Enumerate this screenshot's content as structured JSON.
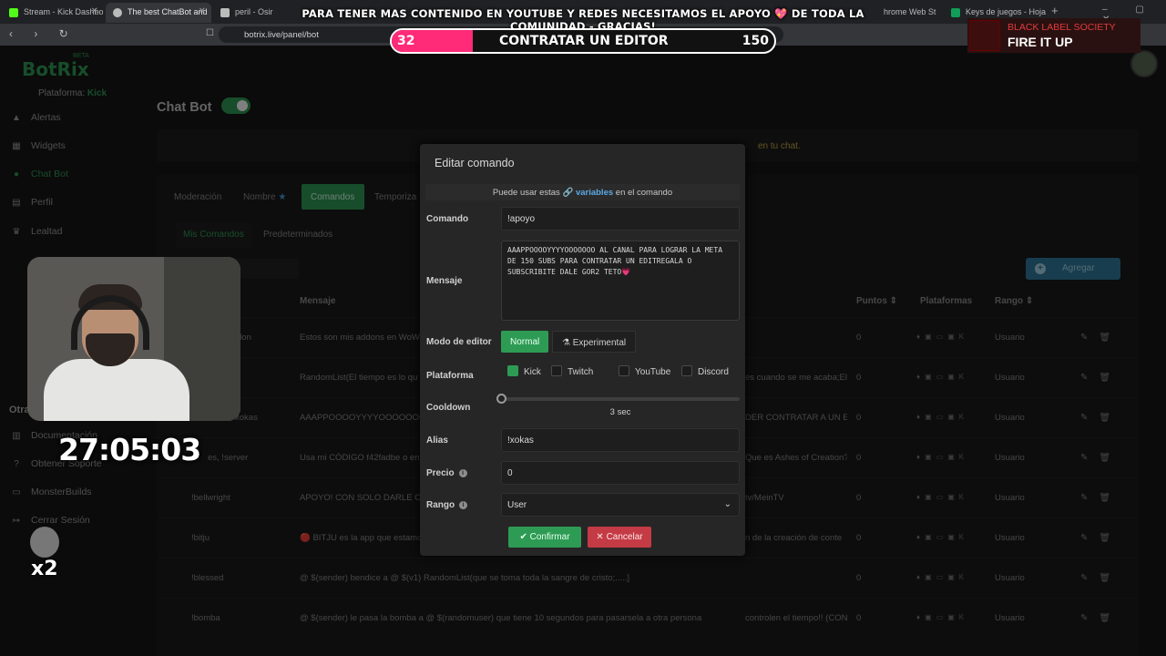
{
  "browser": {
    "tabs": [
      {
        "label": "Stream - Kick Dashbo",
        "active": false,
        "color": "#53fc18"
      },
      {
        "label": "The best ChatBot and",
        "active": true,
        "color": "#bbbbbb"
      },
      {
        "label": "peril - Osiris Ar",
        "active": false,
        "color": "#bbbbbb"
      },
      {
        "label": "hrome Web St",
        "active": false,
        "color": "#4285f4"
      },
      {
        "label": "Keys de juegos - Hojas d",
        "active": false,
        "color": "#0f9d58"
      }
    ],
    "url": "botrix.live/panel/bot"
  },
  "overlay": {
    "banner_prefix": "PARA TENER MAS CONTENIDO EN YOUTUBE Y REDES NECESITAMOS EL APOYO",
    "banner_heart": "💖",
    "banner_suffix": "DE TODA LA COMUNIDAD - GRACIAS!",
    "goal_current": "32",
    "goal_label": "CONTRATAR UN EDITOR",
    "goal_target": "150",
    "goal_progress": 0.213,
    "now_playing_artist": "BLACK LABEL SOCIETY",
    "now_playing_title": "FIRE IT UP",
    "timer": "27:05:03",
    "multiplier": "x2"
  },
  "app": {
    "logo": "BotRix",
    "logo_badge": "BETA",
    "platform_label": "Plataforma:",
    "platform_value": "Kick",
    "nav": [
      {
        "label": "Alertas",
        "icon": "warning-icon",
        "glyph": "▲"
      },
      {
        "label": "Widgets",
        "icon": "grid-icon",
        "glyph": "▦"
      },
      {
        "label": "Chat Bot",
        "icon": "robot-icon",
        "glyph": "●"
      },
      {
        "label": "Perfil",
        "icon": "id-card-icon",
        "glyph": "▤"
      },
      {
        "label": "Lealtad",
        "icon": "trophy-icon",
        "glyph": "♛"
      }
    ],
    "other_section": "Otra",
    "other_nav": [
      {
        "label": "Documentación",
        "icon": "document-icon",
        "glyph": "▥"
      },
      {
        "label": "Obtener Soporte",
        "icon": "help-icon",
        "glyph": "?"
      },
      {
        "label": "MonsterBuilds",
        "icon": "monitor-icon",
        "glyph": "▭"
      },
      {
        "label": "Cerrar Sesión",
        "icon": "logout-icon",
        "glyph": "↦"
      }
    ],
    "page_title": "Chat Bot",
    "info_text": "en tu chat.",
    "tabs": [
      "Moderación",
      "Nombre",
      "Comandos",
      "Temporiza"
    ],
    "subtabs": [
      "Mis Comandos",
      "Predeterminados"
    ],
    "add_button": "Agregar",
    "table_headers": {
      "mensaje": "Mensaje",
      "puntos": "Puntos",
      "plataformas": "Plataformas",
      "rango": "Rango"
    },
    "rows": [
      {
        "cmd": "don",
        "msg": "Estos son mis addons en WoW",
        "pts": "0",
        "rango": "Usuario"
      },
      {
        "cmd": "",
        "msg": "RandomList(El tiempo es lo qu",
        "pts": "0",
        "rango": "Usuario"
      },
      {
        "cmd": "xokas",
        "msg": "AAAPPOOOOYYYYOOOOOOO",
        "pts": "0",
        "rango": "Usuario"
      },
      {
        "cmd": "es, !server",
        "msg": "Usa mi CÓDIGO f42fadbe o en",
        "pts": "0",
        "rango": "Usuario"
      },
      {
        "cmd": "!bellwright",
        "msg": "APOYO! CON SOLO DARLE CL",
        "pts": "0",
        "rango": "Usuario"
      },
      {
        "cmd": "!bitju",
        "msg": "🔴 BITJU es la app que estamo",
        "pts": "0",
        "rango": "Usuario"
      },
      {
        "cmd": "!blessed",
        "msg": "@ $(sender) bendice a @ $(v1) RandomList(que se toma toda la sangre de cristo;.....]",
        "pts": "0",
        "rango": "Usuario"
      },
      {
        "cmd": "!bomba",
        "msg": "@ $(sender) le pasa la bomba a @ $(randomuser) que tiene 10 segundos para pasarsela a otra persona",
        "pts": "0",
        "rango": "Usuario"
      }
    ],
    "row_tails": [
      "",
      "es cuando se me acaba;El",
      "DER CONTRATAR A UN EI",
      "Que es Ashes of Creation?",
      "tv/MeinTV",
      "n de la creación de conte",
      "",
      "controlen el tiempo!! (CON"
    ]
  },
  "modal": {
    "title": "Editar comando",
    "hint_prefix": "Puede usar estas",
    "hint_link": "variables",
    "hint_suffix": "en el comando",
    "labels": {
      "comando": "Comando",
      "mensaje": "Mensaje",
      "modo": "Modo de editor",
      "plataforma": "Plataforma",
      "cooldown": "Cooldown",
      "alias": "Alias",
      "precio": "Precio",
      "rango": "Rango"
    },
    "comando_value": "!apoyo",
    "mensaje_value": "AAAPPOOOOYYYYOOOOOOO AL CANAL PARA LOGRAR LA META\nDE 150 SUBS PARA CONTRATAR UN EDITREGALA O\nSUBSCRIBITE DALE GOR2 TETO💗",
    "modes": [
      "Normal",
      "Experimental"
    ],
    "platforms": [
      {
        "label": "Kick",
        "checked": true
      },
      {
        "label": "Twitch",
        "checked": false
      },
      {
        "label": "YouTube",
        "checked": false
      },
      {
        "label": "Discord",
        "checked": false
      }
    ],
    "cooldown_value": "3 sec",
    "alias_value": "!xokas",
    "precio_value": "0",
    "rango_value": "User",
    "confirm": "Confirmar",
    "cancel": "Cancelar"
  },
  "colors": {
    "accent_green": "#2e9b55",
    "danger_red": "#c43b45",
    "goal_pink": "#ff2a78",
    "info_blue": "#2f7a9c"
  }
}
